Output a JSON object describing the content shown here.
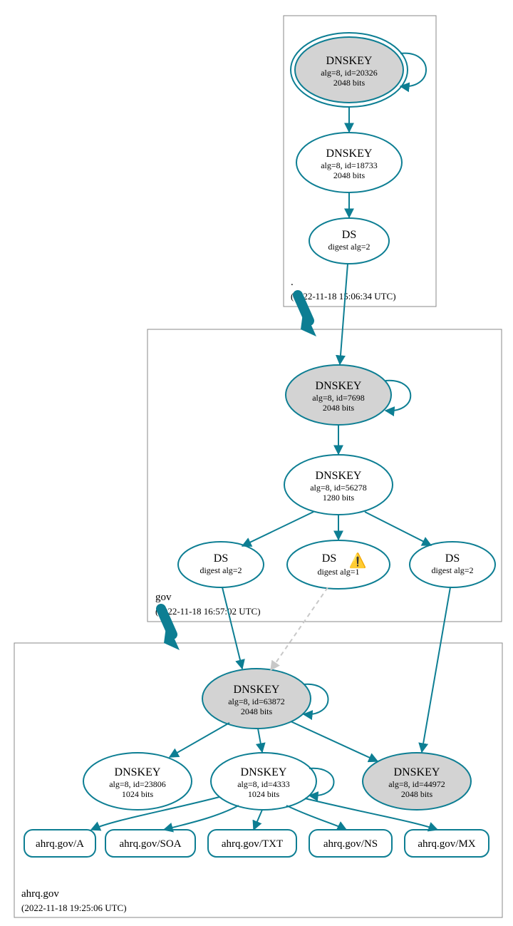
{
  "zones": {
    "root": {
      "label": ".",
      "timestamp": "(2022-11-18 15:06:34 UTC)"
    },
    "gov": {
      "label": "gov",
      "timestamp": "(2022-11-18 16:57:02 UTC)"
    },
    "ahrq": {
      "label": "ahrq.gov",
      "timestamp": "(2022-11-18 19:25:06 UTC)"
    }
  },
  "nodes": {
    "root_ksk": {
      "title": "DNSKEY",
      "line2": "alg=8, id=20326",
      "line3": "2048 bits"
    },
    "root_zsk": {
      "title": "DNSKEY",
      "line2": "alg=8, id=18733",
      "line3": "2048 bits"
    },
    "root_ds": {
      "title": "DS",
      "line2": "digest alg=2"
    },
    "gov_ksk": {
      "title": "DNSKEY",
      "line2": "alg=8, id=7698",
      "line3": "2048 bits"
    },
    "gov_zsk": {
      "title": "DNSKEY",
      "line2": "alg=8, id=56278",
      "line3": "1280 bits"
    },
    "gov_ds1": {
      "title": "DS",
      "line2": "digest alg=2"
    },
    "gov_ds2": {
      "title": "DS",
      "line2": "digest alg=1"
    },
    "gov_ds3": {
      "title": "DS",
      "line2": "digest alg=2"
    },
    "ahrq_ksk": {
      "title": "DNSKEY",
      "line2": "alg=8, id=63872",
      "line3": "2048 bits"
    },
    "ahrq_k2": {
      "title": "DNSKEY",
      "line2": "alg=8, id=23806",
      "line3": "1024 bits"
    },
    "ahrq_zsk": {
      "title": "DNSKEY",
      "line2": "alg=8, id=4333",
      "line3": "1024 bits"
    },
    "ahrq_k4": {
      "title": "DNSKEY",
      "line2": "alg=8, id=44972",
      "line3": "2048 bits"
    }
  },
  "records": {
    "a": "ahrq.gov/A",
    "soa": "ahrq.gov/SOA",
    "txt": "ahrq.gov/TXT",
    "ns": "ahrq.gov/NS",
    "mx": "ahrq.gov/MX"
  },
  "colors": {
    "stroke": "#0d7e93",
    "greyfill": "#d3d3d3"
  }
}
